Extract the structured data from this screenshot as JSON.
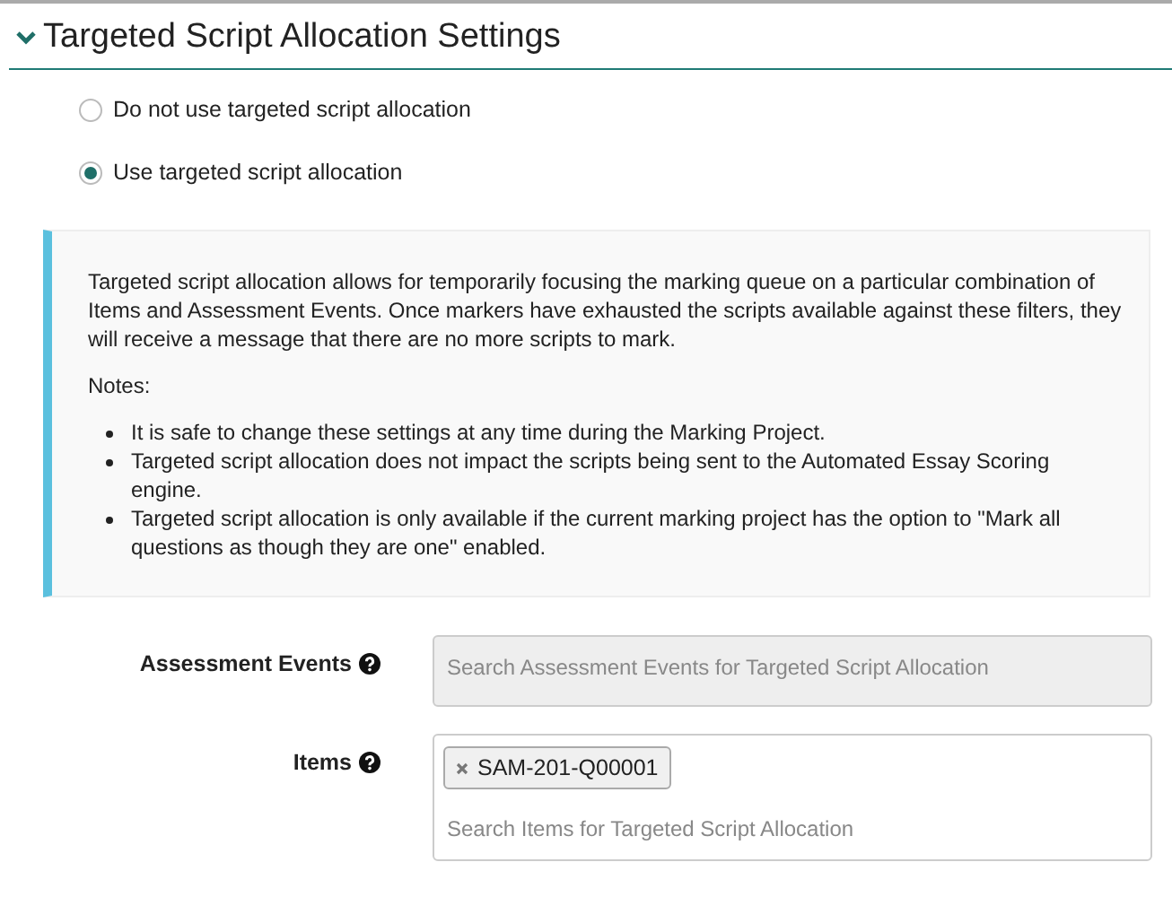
{
  "section": {
    "title": "Targeted Script Allocation Settings",
    "expanded": true
  },
  "options": [
    {
      "label": "Do not use targeted script allocation",
      "selected": false
    },
    {
      "label": "Use targeted script allocation",
      "selected": true
    }
  ],
  "info": {
    "text": "Targeted script allocation allows for temporarily focusing the marking queue on a particular combination of Items and Assessment Events. Once markers have exhausted the scripts available against these filters, they will receive a message that there are no more scripts to mark.",
    "notes_label": "Notes:",
    "notes": [
      "It is safe to change these settings at any time during the Marking Project.",
      "Targeted script allocation does not impact the scripts being sent to the Automated Essay Scoring engine.",
      "Targeted script allocation is only available if the current marking project has the option to \"Mark all questions as though they are one\" enabled."
    ]
  },
  "fields": [
    {
      "label": "Assessment Events",
      "placeholder": "Search Assessment Events for Targeted Script Allocation",
      "disabled": true
    },
    {
      "label": "Items",
      "placeholder": "Search Items for Targeted Script Allocation",
      "disabled": false,
      "tags": [
        "SAM-201-Q00001"
      ]
    }
  ]
}
